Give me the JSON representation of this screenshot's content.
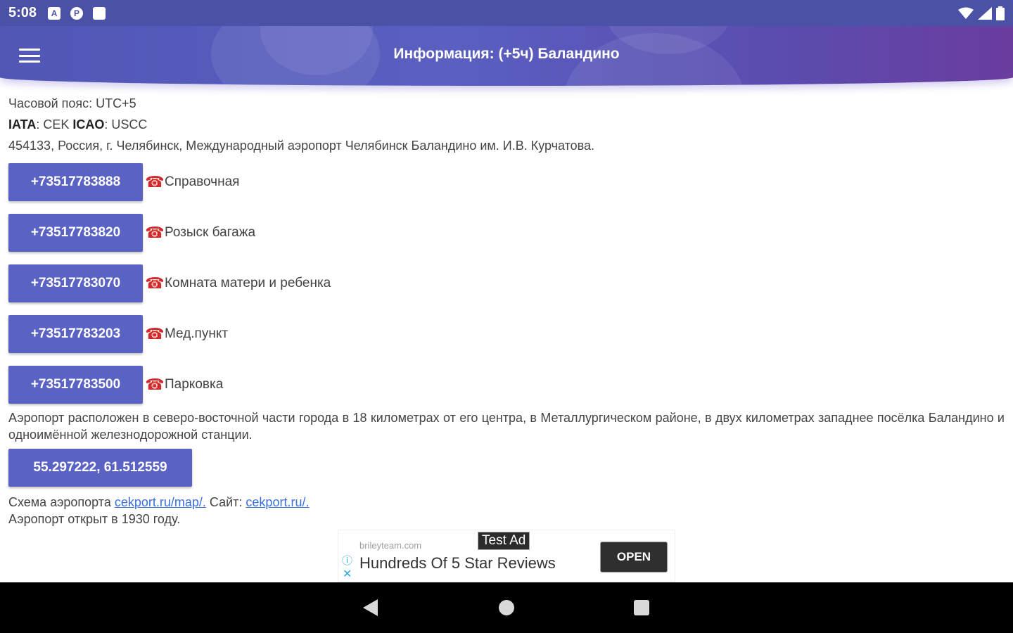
{
  "status_bar": {
    "time": "5:08",
    "icons": [
      "notification-a-icon",
      "notification-p-icon",
      "sd-card-icon"
    ],
    "right_icons": [
      "wifi-icon",
      "signal-icon",
      "battery-icon"
    ]
  },
  "app_bar": {
    "title": "Информация: (+5ч) Баландино",
    "menu_icon": "hamburger-menu-icon"
  },
  "info": {
    "timezone": "Часовой пояс: UTC+5",
    "iata_label": "IATA",
    "iata_value": ": CEK ",
    "icao_label": "ICAO",
    "icao_value": ": USCC",
    "address": "454133, Россия, г. Челябинск, Международный аэропорт Челябинск Баландино им. И.В. Курчатова."
  },
  "phones": [
    {
      "number": "+73517783888",
      "label": "Справочная"
    },
    {
      "number": "+73517783820",
      "label": "Розыск багажа"
    },
    {
      "number": "+73517783070",
      "label": "Комната матери и ребенка"
    },
    {
      "number": "+73517783203",
      "label": "Мед.пункт"
    },
    {
      "number": "+73517783500",
      "label": "Парковка"
    }
  ],
  "phone_icon_glyph": "☎",
  "description": "Аэропорт расположен в северо-восточной части города в 18 километрах от его центра, в Металлургическом районе, в двух километрах западнее посёлка Баландино и одноимённой железнодорожной станции.",
  "coordinates": "55.297222, 61.512559",
  "links": {
    "scheme_prefix": "Схема аэропорта ",
    "scheme_link": "cekport.ru/map/.",
    "site_prefix": " Сайт: ",
    "site_link": "cekport.ru/.",
    "opened": "Аэропорт открыт в 1930 году."
  },
  "ad": {
    "domain": "brileyteam.com",
    "badge": "Test Ad",
    "headline": "Hundreds Of 5 Star Reviews",
    "open_label": "OPEN"
  },
  "colors": {
    "accent": "#5a62c4",
    "appbar_start": "#5257b6",
    "appbar_end": "#6a3d9f",
    "phone_icon": "#d12a2a",
    "link": "#3b6fd8"
  }
}
